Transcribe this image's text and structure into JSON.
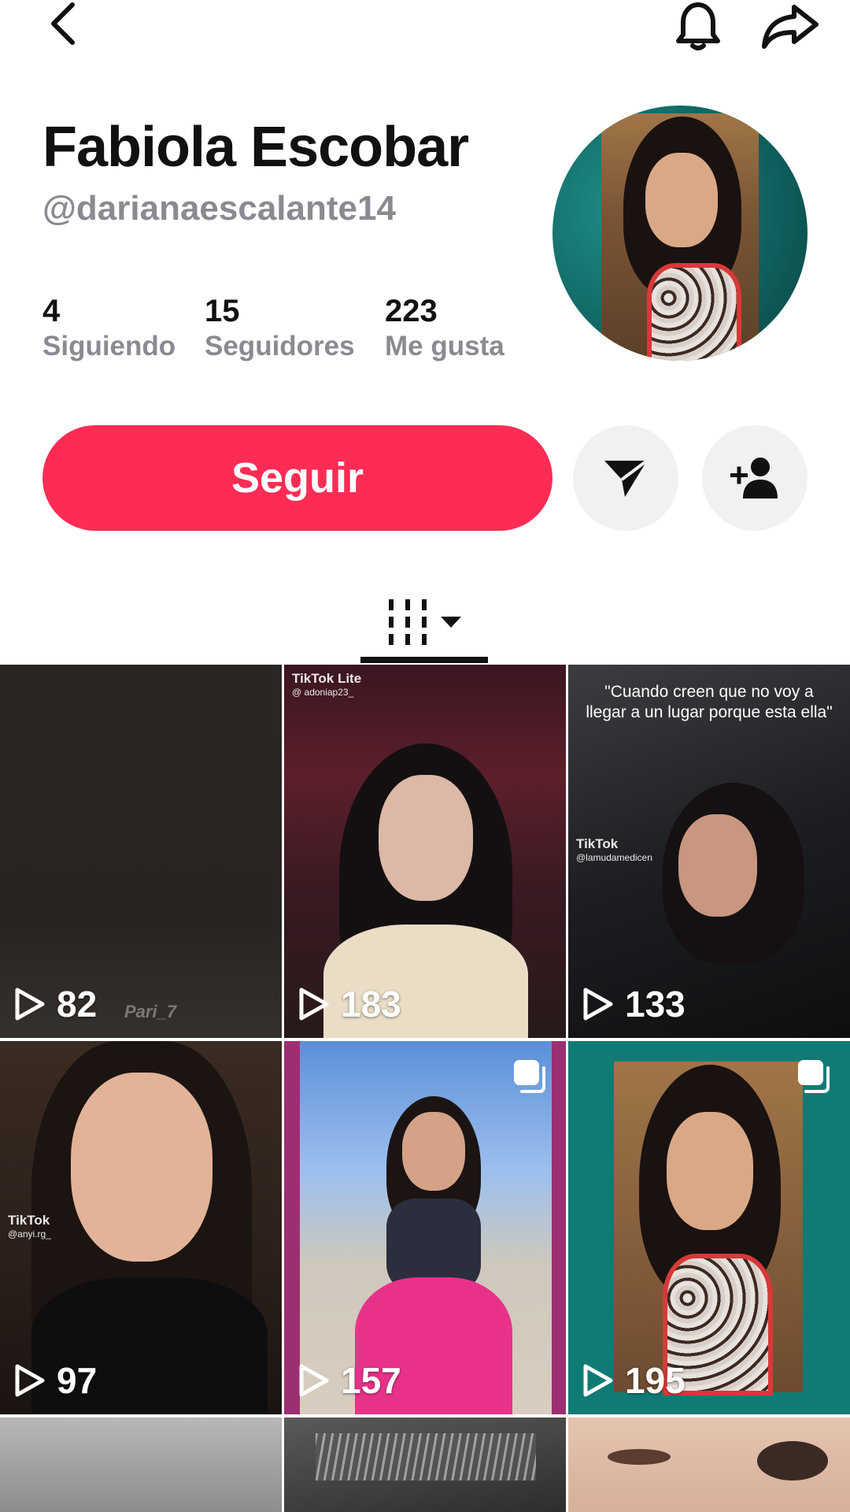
{
  "header": {
    "back_icon": "chevron-left-icon",
    "bell_icon": "bell-icon",
    "share_icon": "share-arrow-icon"
  },
  "profile": {
    "name": "Fabiola Escobar",
    "handle": "@darianaescalante14",
    "stats": [
      {
        "count": "4",
        "label": "Siguiendo"
      },
      {
        "count": "15",
        "label": "Seguidores"
      },
      {
        "count": "223",
        "label": "Me gusta"
      }
    ]
  },
  "actions": {
    "follow_label": "Seguir",
    "message_icon": "send-icon",
    "add_friend_icon": "add-user-icon",
    "accent_color": "#fe2c55"
  },
  "tabs": {
    "active_icon": "grid-icon",
    "dropdown_icon": "caret-down-icon"
  },
  "videos": [
    {
      "views": "82",
      "watermark": "Pari_7"
    },
    {
      "views": "183",
      "watermark": "TikTok Lite",
      "watermark_user": "@ adoniap23_"
    },
    {
      "views": "133",
      "caption": "\"Cuando creen que no voy a llegar a un lugar porque esta ella\"",
      "watermark": "TikTok",
      "watermark_user": "@lamudamedicen"
    },
    {
      "views": "97",
      "watermark": "TikTok",
      "watermark_user": "@anyi.rg_"
    },
    {
      "views": "157",
      "multi_icon": "multi-photo-icon"
    },
    {
      "views": "195",
      "multi_icon": "multi-photo-icon"
    },
    {
      "views": ""
    },
    {
      "views": ""
    },
    {
      "views": ""
    }
  ]
}
